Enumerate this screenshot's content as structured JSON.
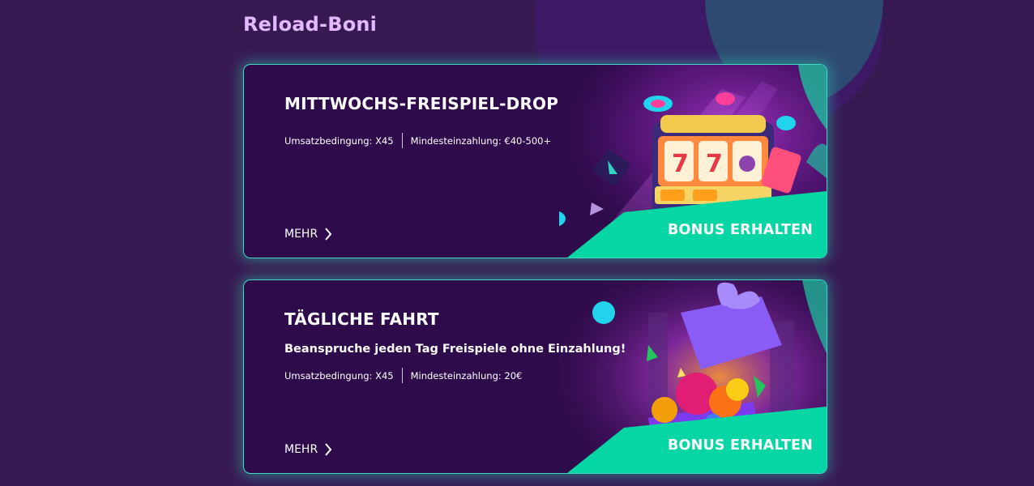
{
  "section": {
    "title": "Reload-Boni"
  },
  "cards": [
    {
      "title": "MITTWOCHS-FREISPIEL-DROP",
      "subtitle": "",
      "wagering": "Umsatzbedingung: X45",
      "min_deposit": "Mindesteinzahlung: €40-500+",
      "more_label": "MEHR",
      "cta_label": "BONUS ERHALTEN",
      "art": "slot-machine"
    },
    {
      "title": "TÄGLICHE FAHRT",
      "subtitle": "Beanspruche jeden Tag Freispiele ohne Einzahlung!",
      "wagering": "Umsatzbedingung: X45",
      "min_deposit": "Mindesteinzahlung: 20€",
      "more_label": "MEHR",
      "cta_label": "BONUS ERHALTEN",
      "art": "gift-box-with-fruits"
    }
  ],
  "colors": {
    "background": "#381a52",
    "card": "#2e0b4a",
    "accent": "#06d6a3",
    "title": "#e2b8ff"
  },
  "icons": [
    "chevron-right-icon"
  ]
}
